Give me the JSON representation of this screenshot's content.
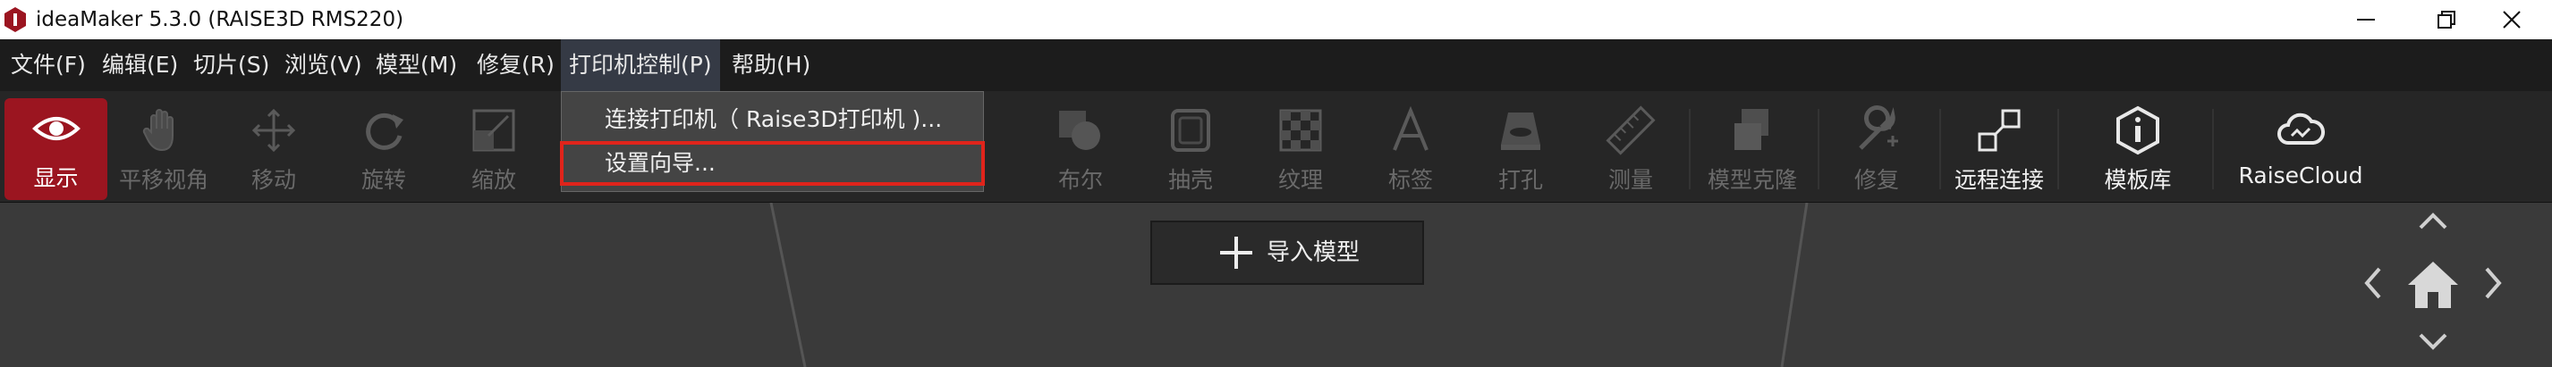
{
  "window": {
    "title": "ideaMaker 5.3.0 (RAISE3D RMS220)",
    "controls": [
      "minimize-icon",
      "restore-icon",
      "close-icon"
    ]
  },
  "menubar": {
    "items": [
      {
        "label": "文件(F)"
      },
      {
        "label": "编辑(E)"
      },
      {
        "label": "切片(S)"
      },
      {
        "label": "浏览(V)"
      },
      {
        "label": "模型(M)"
      },
      {
        "label": "修复(R)"
      },
      {
        "label": "打印机控制(P)",
        "open": true
      },
      {
        "label": "帮助(H)"
      }
    ]
  },
  "toolbar": {
    "items": [
      {
        "label": "显示",
        "icon": "eye-icon",
        "state": "active"
      },
      {
        "label": "平移视角",
        "icon": "hand-icon",
        "state": "disabled"
      },
      {
        "label": "移动",
        "icon": "move-arrows-icon",
        "state": "disabled"
      },
      {
        "label": "旋转",
        "icon": "rotate-icon",
        "state": "disabled"
      },
      {
        "label": "缩放",
        "icon": "scale-icon",
        "state": "disabled"
      },
      {
        "label": "布尔",
        "icon": "boolean-icon",
        "state": "disabled"
      },
      {
        "label": "抽壳",
        "icon": "shell-icon",
        "state": "disabled"
      },
      {
        "label": "纹理",
        "icon": "texture-icon",
        "state": "disabled"
      },
      {
        "label": "标签",
        "icon": "text-label-icon",
        "state": "disabled"
      },
      {
        "label": "打孔",
        "icon": "hole-icon",
        "state": "disabled"
      },
      {
        "label": "测量",
        "icon": "ruler-icon",
        "state": "disabled"
      },
      {
        "label": "模型克隆",
        "icon": "clone-icon",
        "state": "disabled"
      },
      {
        "label": "修复",
        "icon": "wrench-icon",
        "state": "disabled"
      },
      {
        "label": "远程连接",
        "icon": "remote-connect-icon",
        "state": "enabled"
      },
      {
        "label": "模板库",
        "icon": "info-hexagon-icon",
        "state": "enabled"
      },
      {
        "label": "RaiseCloud",
        "icon": "cloud-icon",
        "state": "enabled"
      }
    ]
  },
  "dropdown": {
    "items": [
      {
        "label": "连接打印机（ Raise3D打印机 )..."
      },
      {
        "label": "设置向导...",
        "highlighted": true
      }
    ]
  },
  "viewport": {
    "import_label": "导入模型",
    "nav": [
      "arrow-up-icon",
      "arrow-left-icon",
      "home-icon",
      "arrow-right-icon",
      "arrow-down-icon"
    ]
  },
  "colors": {
    "accent": "#9b1520",
    "highlight_border": "#e0241b",
    "menubar_bg": "#1c1c1c",
    "toolbar_bg": "#262626",
    "viewport_bg": "#3a3a3a"
  }
}
